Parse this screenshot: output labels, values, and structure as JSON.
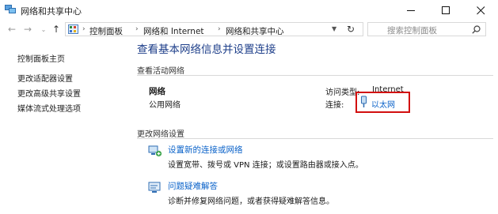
{
  "window": {
    "title": "网络和共享中心",
    "minimize_icon": "minimize-icon",
    "maximize_icon": "maximize-icon",
    "close_icon": "close-icon"
  },
  "address_bar": {
    "breadcrumbs": [
      "控制面板",
      "网络和 Internet",
      "网络和共享中心"
    ],
    "search_placeholder": "搜索控制面板"
  },
  "sidebar": {
    "items": [
      {
        "label": "控制面板主页"
      },
      {
        "label": "更改适配器设置"
      },
      {
        "label": "更改高级共享设置"
      },
      {
        "label": "媒体流式处理选项"
      }
    ]
  },
  "main": {
    "title": "查看基本网络信息并设置连接",
    "active_section_label": "查看活动网络",
    "network_name": "网络",
    "network_type": "公用网络",
    "access_type_label": "访问类型:",
    "access_type_value": "Internet",
    "connection_label": "连接:",
    "connection_value": "以太网",
    "change_section_label": "更改网络设置",
    "tasks": [
      {
        "title": "设置新的连接或网络",
        "description": "设置宽带、拨号或 VPN 连接；或设置路由器或接入点。",
        "icon": "new-connection-icon"
      },
      {
        "title": "问题疑难解答",
        "description": "诊断并修复网络问题，或者获得疑难解答信息。",
        "icon": "troubleshoot-icon"
      }
    ]
  },
  "colors": {
    "accent": "#1e3f8a",
    "link": "#0a62c9",
    "highlight": "#d20f0f"
  }
}
